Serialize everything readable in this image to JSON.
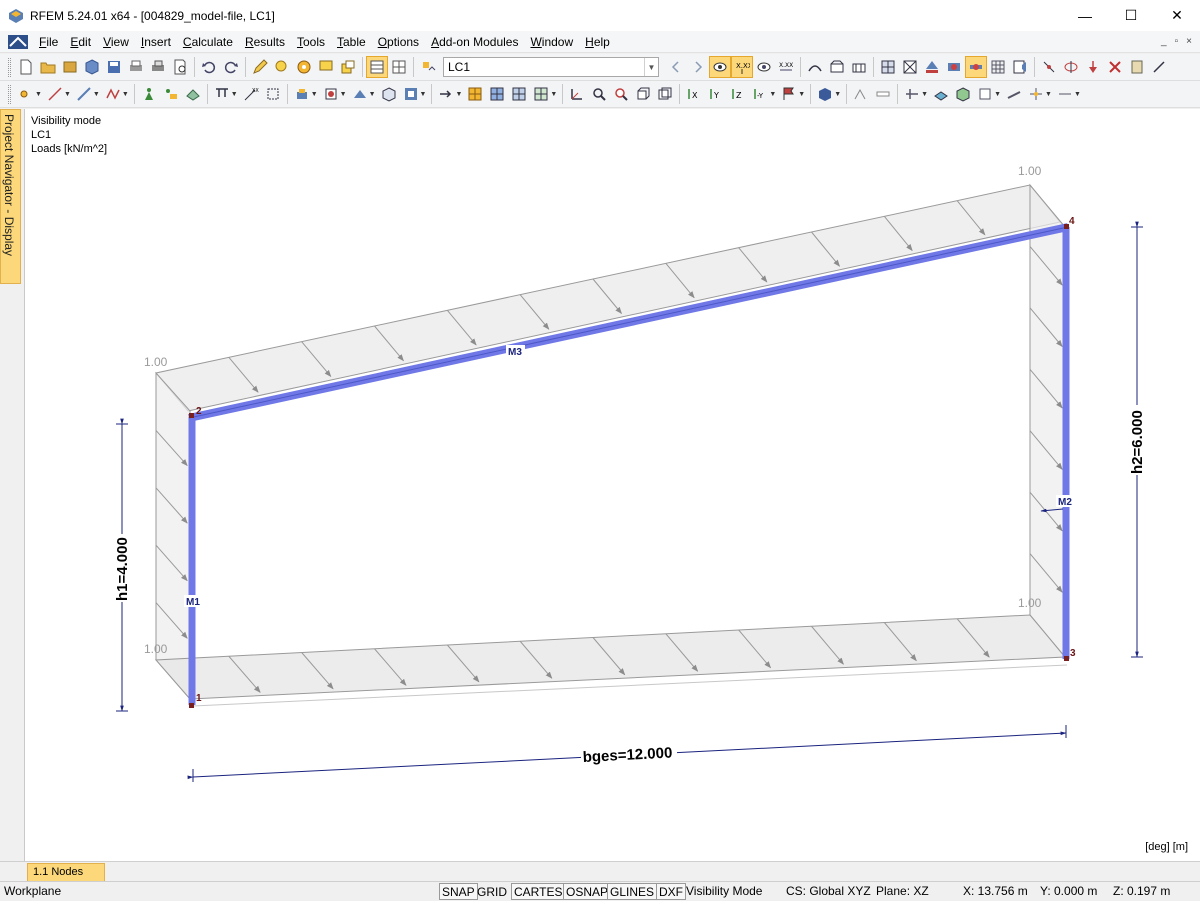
{
  "window": {
    "title": "RFEM 5.24.01 x64 - [004829_model-file, LC1]",
    "controls": {
      "minimize": "—",
      "maximize": "☐",
      "close": "✕"
    }
  },
  "menu": {
    "items": [
      "File",
      "Edit",
      "View",
      "Insert",
      "Calculate",
      "Results",
      "Tools",
      "Table",
      "Options",
      "Add-on Modules",
      "Window",
      "Help"
    ],
    "mdi": {
      "minimize": "_",
      "restore": "▫",
      "close": "×"
    }
  },
  "toolbar": {
    "load_case": "LC1",
    "active_color": "#fcd87a"
  },
  "navigator": {
    "tab_label": "Project Navigator - Display"
  },
  "viewport": {
    "info_lines": [
      "Visibility mode",
      "LC1",
      "Loads [kN/m^2]"
    ],
    "units": "[deg] [m]",
    "member_color": "#6f78e6",
    "dimension_color": "#1a237e",
    "load_values": [
      "1.00",
      "1.00",
      "1.00",
      "1.00"
    ],
    "nodes": [
      "1",
      "2",
      "3",
      "4"
    ],
    "members": [
      "M1",
      "M2",
      "M3"
    ],
    "dimensions": {
      "h1": "h1=4.000",
      "h2": "h2=6.000",
      "bges": "bges=12.000"
    }
  },
  "bottom_tab": {
    "label": "1.1 Nodes"
  },
  "status": {
    "workplane": "Workplane",
    "toggles": [
      {
        "label": "SNAP",
        "on": true
      },
      {
        "label": "GRID",
        "on": false
      },
      {
        "label": "CARTES",
        "on": true
      },
      {
        "label": "OSNAP",
        "on": true
      },
      {
        "label": "GLINES",
        "on": true
      },
      {
        "label": "DXF",
        "on": true
      }
    ],
    "mode": "Visibility Mode",
    "cs": "CS: Global XYZ",
    "plane": "Plane: XZ",
    "x": "X:  13.756 m",
    "y": "Y:  0.000 m",
    "z": "Z:  0.197 m"
  }
}
